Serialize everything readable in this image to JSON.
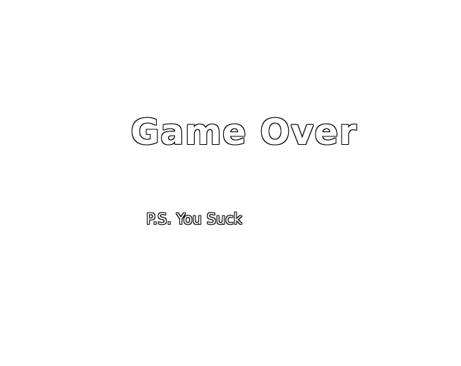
{
  "game_over": {
    "title": "Game Over",
    "subtitle": "P.S. You Suck"
  },
  "colors": {
    "background": "#ffffff",
    "text_fill": "#ffffff",
    "text_outline": "#000000"
  }
}
